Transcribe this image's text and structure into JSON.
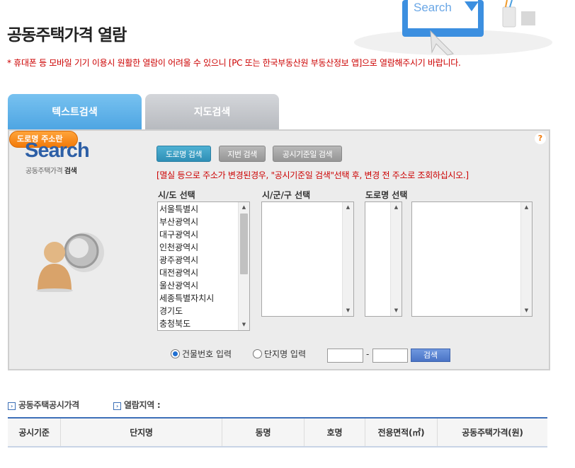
{
  "header": {
    "title": "공동주택가격 열람",
    "notice": "* 휴대폰 등 모바일 기기 이용시 원활한 열람이 어려울 수 있으니 [PC 또는 한국부동산원 부동산정보 앱]으로 열람해주시기 바랍니다.",
    "hero_text": "Search"
  },
  "tabs": [
    {
      "label": "텍스트검색",
      "active": true
    },
    {
      "label": "지도검색",
      "active": false
    }
  ],
  "search_panel": {
    "logo_word": "Search",
    "logo_sub_prefix": "공동주택가격",
    "logo_sub_bold": "검색",
    "mode_buttons": {
      "road": "도로명 검색",
      "lot": "지번 검색",
      "date": "공시기준일 검색"
    },
    "guide_button": "도로명 주소란",
    "guide_icon": "?",
    "warning": "[멸실 등으로 주소가 변경된경우, \"공시기준일 검색\"선택 후, 변경 전 주소로 조회하십시오.]",
    "labels": {
      "sido": "시/도 선택",
      "sigungu": "시/군/구 선택",
      "road": "도로명 선택"
    },
    "sido_options": [
      "서울특별시",
      "부산광역시",
      "대구광역시",
      "인천광역시",
      "광주광역시",
      "대전광역시",
      "울산광역시",
      "세종특별자치시",
      "경기도",
      "충청북도"
    ],
    "radio": {
      "building": "건물번호 입력",
      "complex": "단지명 입력",
      "selected": "building"
    },
    "number_dash": "-",
    "number_from": "",
    "number_to": "",
    "search_button": "검색"
  },
  "links": {
    "price": "공동주택공시가격",
    "region": "열람지역 :"
  },
  "table": {
    "headers": [
      "공시기준",
      "단지명",
      "동명",
      "호명",
      "전용면적(㎡)",
      "공동주택가격(원)"
    ]
  },
  "colors": {
    "active_tab": "#4ca4e2",
    "inactive_tab": "#b6b9be",
    "notice_red": "#cc0000",
    "logo_blue": "#2d5fa6",
    "guide_orange": "#f27a0a"
  }
}
